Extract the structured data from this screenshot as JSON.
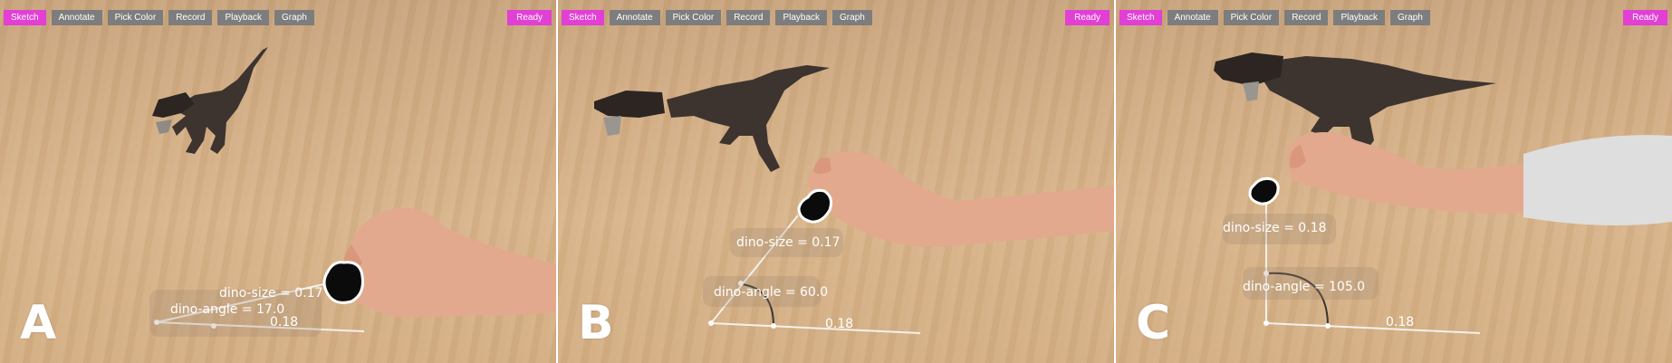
{
  "toolbar": {
    "buttons": [
      "Sketch",
      "Annotate",
      "Pick Color",
      "Record",
      "Playback",
      "Graph"
    ],
    "active": "Sketch",
    "status": "Ready"
  },
  "panels": [
    {
      "letter": "A",
      "dino_size_label": "dino-size = 0.17",
      "dino_angle_label": "dino-angle = 17.0",
      "length_label": "0.18"
    },
    {
      "letter": "B",
      "dino_size_label": "dino-size = 0.17",
      "dino_angle_label": "dino-angle = 60.0",
      "length_label": "0.18"
    },
    {
      "letter": "C",
      "dino_size_label": "dino-size = 0.18",
      "dino_angle_label": "dino-angle = 105.0",
      "length_label": "0.18"
    }
  ],
  "colors": {
    "accent": "#e23fd4",
    "button": "#7d7d7d",
    "table": "#d2ad84",
    "dino": "#3d3430",
    "hand": "#e2a98f"
  },
  "icons": [
    "dinosaur-model-icon",
    "hand-icon",
    "grab-blob-icon"
  ]
}
